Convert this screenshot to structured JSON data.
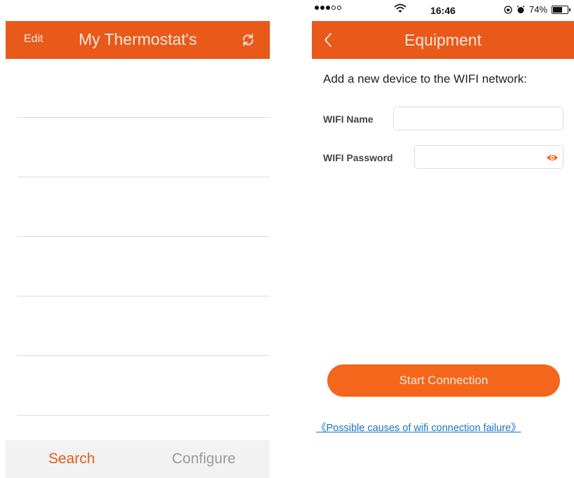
{
  "colors": {
    "accent": "#e8591a",
    "button": "#f4661b",
    "link": "#1a73c7",
    "tab_inactive": "#9a9a9a"
  },
  "left": {
    "header": {
      "edit_label": "Edit",
      "title": "My Thermostat's",
      "refresh_icon": "refresh-icon"
    },
    "list": {
      "row_count": 6
    },
    "tabs": [
      {
        "label": "Search",
        "active": true
      },
      {
        "label": "Configure",
        "active": false
      }
    ]
  },
  "right": {
    "status_bar": {
      "time": "16:46",
      "battery": "74%",
      "battery_level": 0.74,
      "signal_bars_filled": 3,
      "signal_bars_total": 5
    },
    "header": {
      "title": "Equipment",
      "back_icon": "chevron-left-icon"
    },
    "prompt": "Add a new device to the WIFI network:",
    "form": {
      "wifi_name_label": "WIFI Name",
      "wifi_name_value": "",
      "wifi_password_label": "WIFI Password",
      "wifi_password_value": "",
      "show_password_icon": "eye-icon"
    },
    "start_button": "Start Connection",
    "help_link": "《Possible causes of wifi connection failure》"
  }
}
